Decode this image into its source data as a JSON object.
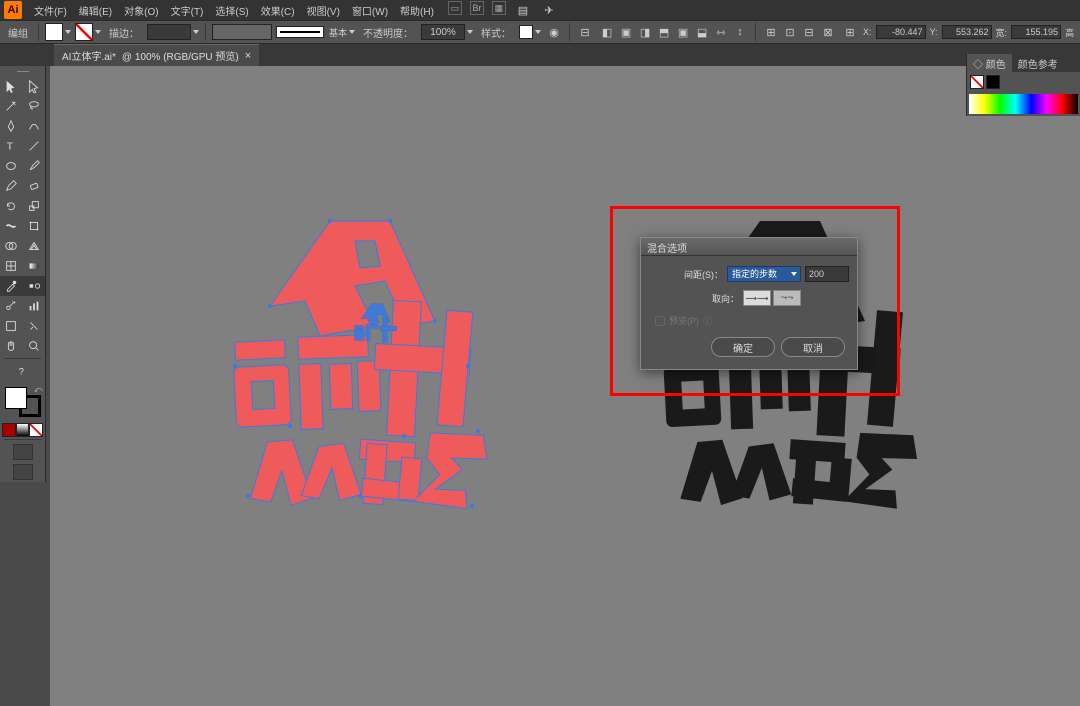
{
  "app": {
    "logo": "Ai"
  },
  "menu": {
    "items": [
      "文件(F)",
      "编辑(E)",
      "对象(O)",
      "文字(T)",
      "选择(S)",
      "效果(C)",
      "视图(V)",
      "窗口(W)",
      "帮助(H)"
    ]
  },
  "control": {
    "mode_label": "编组",
    "stroke_label": "描边：",
    "stroke_weight": "",
    "stroke_style": "基本",
    "opacity_label": "不透明度：",
    "opacity_value": "100%",
    "style_label": "样式：",
    "x_label": "X:",
    "x_value": "-80.447",
    "y_label": "Y:",
    "y_value": "553.262",
    "w_label": "宽:",
    "w_value": "155.195",
    "h_label": "高"
  },
  "tab": {
    "name": "AI立体字.ai*",
    "zoom": "@ 100% (RGB/GPU 预览)"
  },
  "dialog": {
    "title": "混合选项",
    "spacing_label": "间距(S)：",
    "spacing_mode": "指定的步数",
    "spacing_value": "200",
    "orientation_label": "取向：",
    "preview_label": "预览(P)",
    "ok": "确定",
    "cancel": "取消"
  },
  "right_panel": {
    "tab1": "◇ 颜色",
    "tab2": "颜色参考"
  },
  "tools": [
    [
      "selection",
      "direct-selection"
    ],
    [
      "magic-wand",
      "lasso"
    ],
    [
      "pen",
      "curvature"
    ],
    [
      "type",
      "line"
    ],
    [
      "ellipse",
      "brush"
    ],
    [
      "pencil",
      "eraser"
    ],
    [
      "rotate",
      "scale"
    ],
    [
      "width",
      "free-transform"
    ],
    [
      "shape-builder",
      "perspective"
    ],
    [
      "mesh",
      "gradient"
    ],
    [
      "eyedropper",
      "blend"
    ],
    [
      "symbol-sprayer",
      "graph"
    ],
    [
      "artboard",
      "slice"
    ],
    [
      "hand",
      "zoom"
    ]
  ]
}
